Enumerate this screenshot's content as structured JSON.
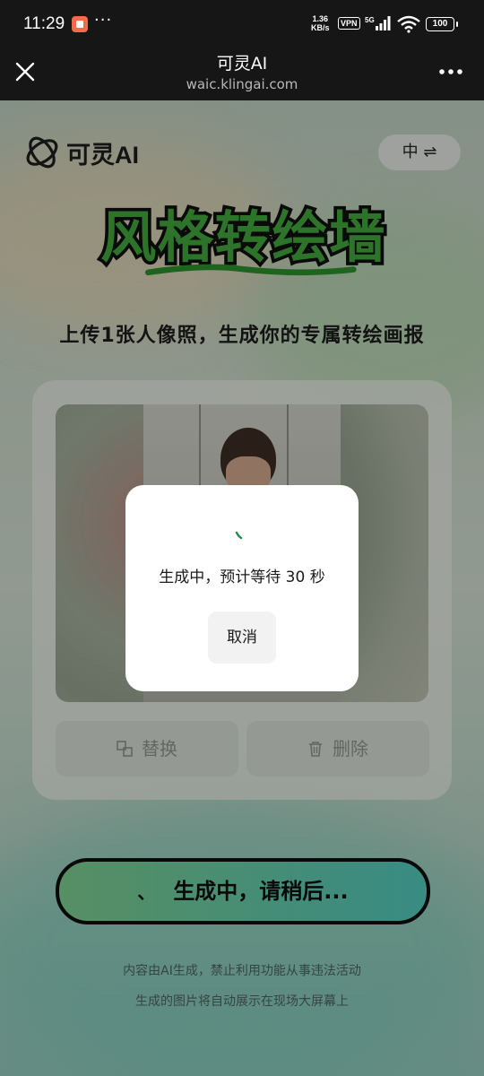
{
  "status_bar": {
    "time": "11:29",
    "more": "···",
    "speed_value": "1.36",
    "speed_unit": "KB/s",
    "vpn": "VPN",
    "network": "5G",
    "battery": "100"
  },
  "title_bar": {
    "title": "可灵AI",
    "url": "waic.klingai.com"
  },
  "page": {
    "logo_text": "可灵AI",
    "lang_toggle": "中 ⇌",
    "headline": "风格转绘墙",
    "subtitle": "上传1张人像照，生成你的专属转绘画报",
    "replace_button": "替换",
    "delete_button": "删除",
    "generate_spinner": "、",
    "generate_button": "生成中，请稍后...",
    "note_line1": "内容由AI生成，禁止利用功能从事违法活动",
    "note_line2": "生成的图片将自动展示在现场大屏幕上"
  },
  "dialog": {
    "message": "生成中，预计等待 30 秒",
    "cancel_label": "取消"
  },
  "colors": {
    "accent_green": "#3fa03a",
    "generate_button_bg": "#5fc4a6",
    "dialog_bg": "#ffffff"
  }
}
